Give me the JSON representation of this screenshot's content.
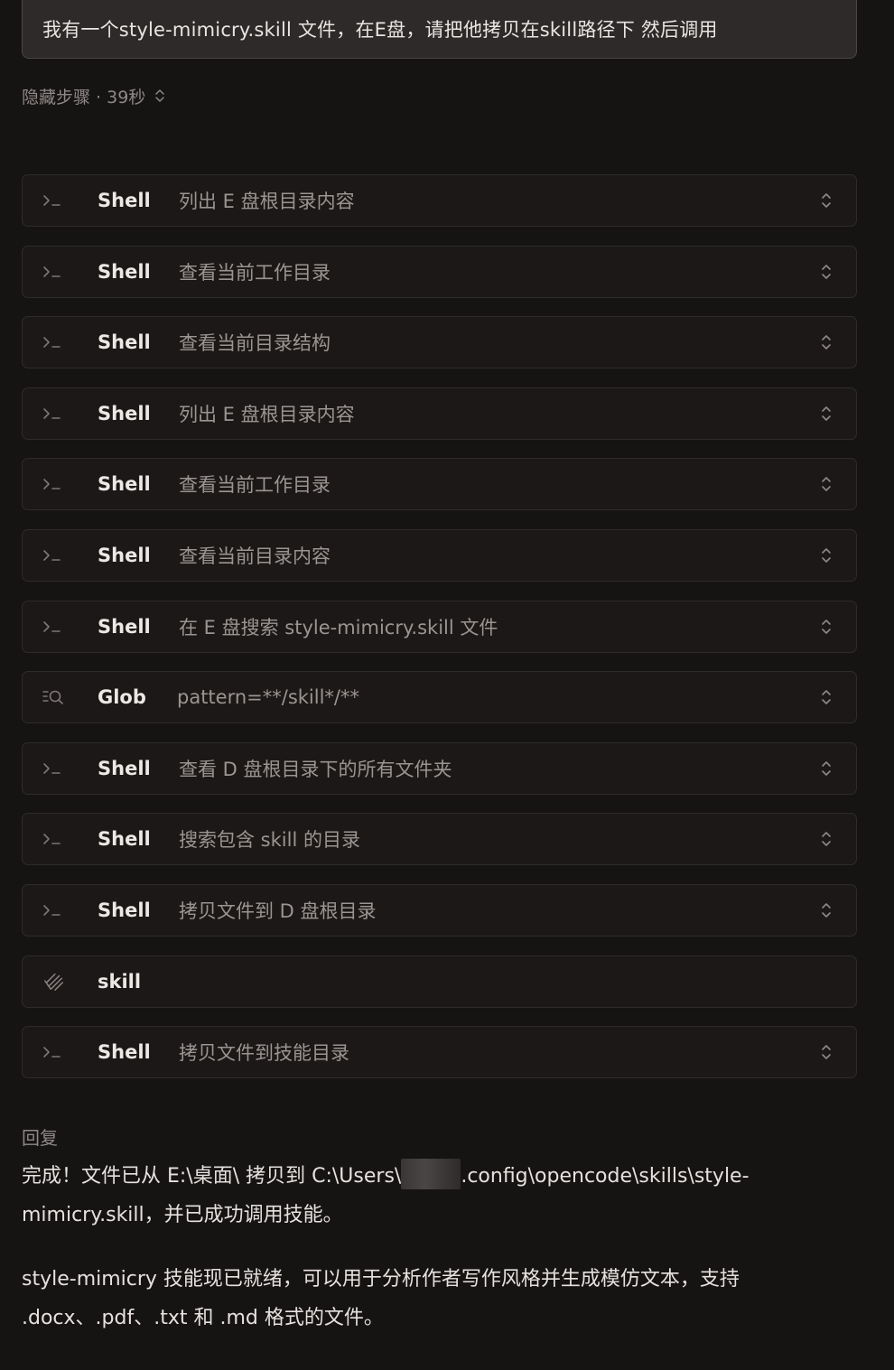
{
  "user_message": "我有一个style-mimicry.skill 文件，在E盘，请把他拷贝在skill路径下 然后调用",
  "steps_toggle": {
    "label": "隐藏步骤 · 39秒",
    "icon": "chevron-up-down-icon"
  },
  "steps": [
    {
      "icon": "terminal-icon",
      "tool": "Shell",
      "desc": "列出 E 盘根目录内容",
      "expandable": true
    },
    {
      "icon": "terminal-icon",
      "tool": "Shell",
      "desc": "查看当前工作目录",
      "expandable": true
    },
    {
      "icon": "terminal-icon",
      "tool": "Shell",
      "desc": "查看当前目录结构",
      "expandable": true
    },
    {
      "icon": "terminal-icon",
      "tool": "Shell",
      "desc": "列出 E 盘根目录内容",
      "expandable": true
    },
    {
      "icon": "terminal-icon",
      "tool": "Shell",
      "desc": "查看当前工作目录",
      "expandable": true
    },
    {
      "icon": "terminal-icon",
      "tool": "Shell",
      "desc": "查看当前目录内容",
      "expandable": true
    },
    {
      "icon": "terminal-icon",
      "tool": "Shell",
      "desc": "在 E 盘搜索 style-mimicry.skill 文件",
      "expandable": true
    },
    {
      "icon": "glob-search-icon",
      "tool": "Glob",
      "desc": "pattern=**/skill*/**",
      "expandable": true
    },
    {
      "icon": "terminal-icon",
      "tool": "Shell",
      "desc": "查看 D 盘根目录下的所有文件夹",
      "expandable": true
    },
    {
      "icon": "terminal-icon",
      "tool": "Shell",
      "desc": "搜索包含 skill 的目录",
      "expandable": true
    },
    {
      "icon": "terminal-icon",
      "tool": "Shell",
      "desc": "拷贝文件到 D 盘根目录",
      "expandable": true
    },
    {
      "icon": "skill-icon",
      "tool": "skill",
      "desc": "",
      "expandable": false
    },
    {
      "icon": "terminal-icon",
      "tool": "Shell",
      "desc": "拷贝文件到技能目录",
      "expandable": true
    }
  ],
  "reply": {
    "label": "回复",
    "para1_before": "完成！文件已从 E:\\桌面\\ 拷贝到 C:\\Users\\",
    "para1_after": ".config\\opencode\\skills\\style-mimicry.skill，并已成功调用技能。",
    "para2": "style-mimicry 技能现已就绪，可以用于分析作者写作风格并生成模仿文本，支持 .docx、.pdf、.txt 和 .md 格式的文件。"
  }
}
